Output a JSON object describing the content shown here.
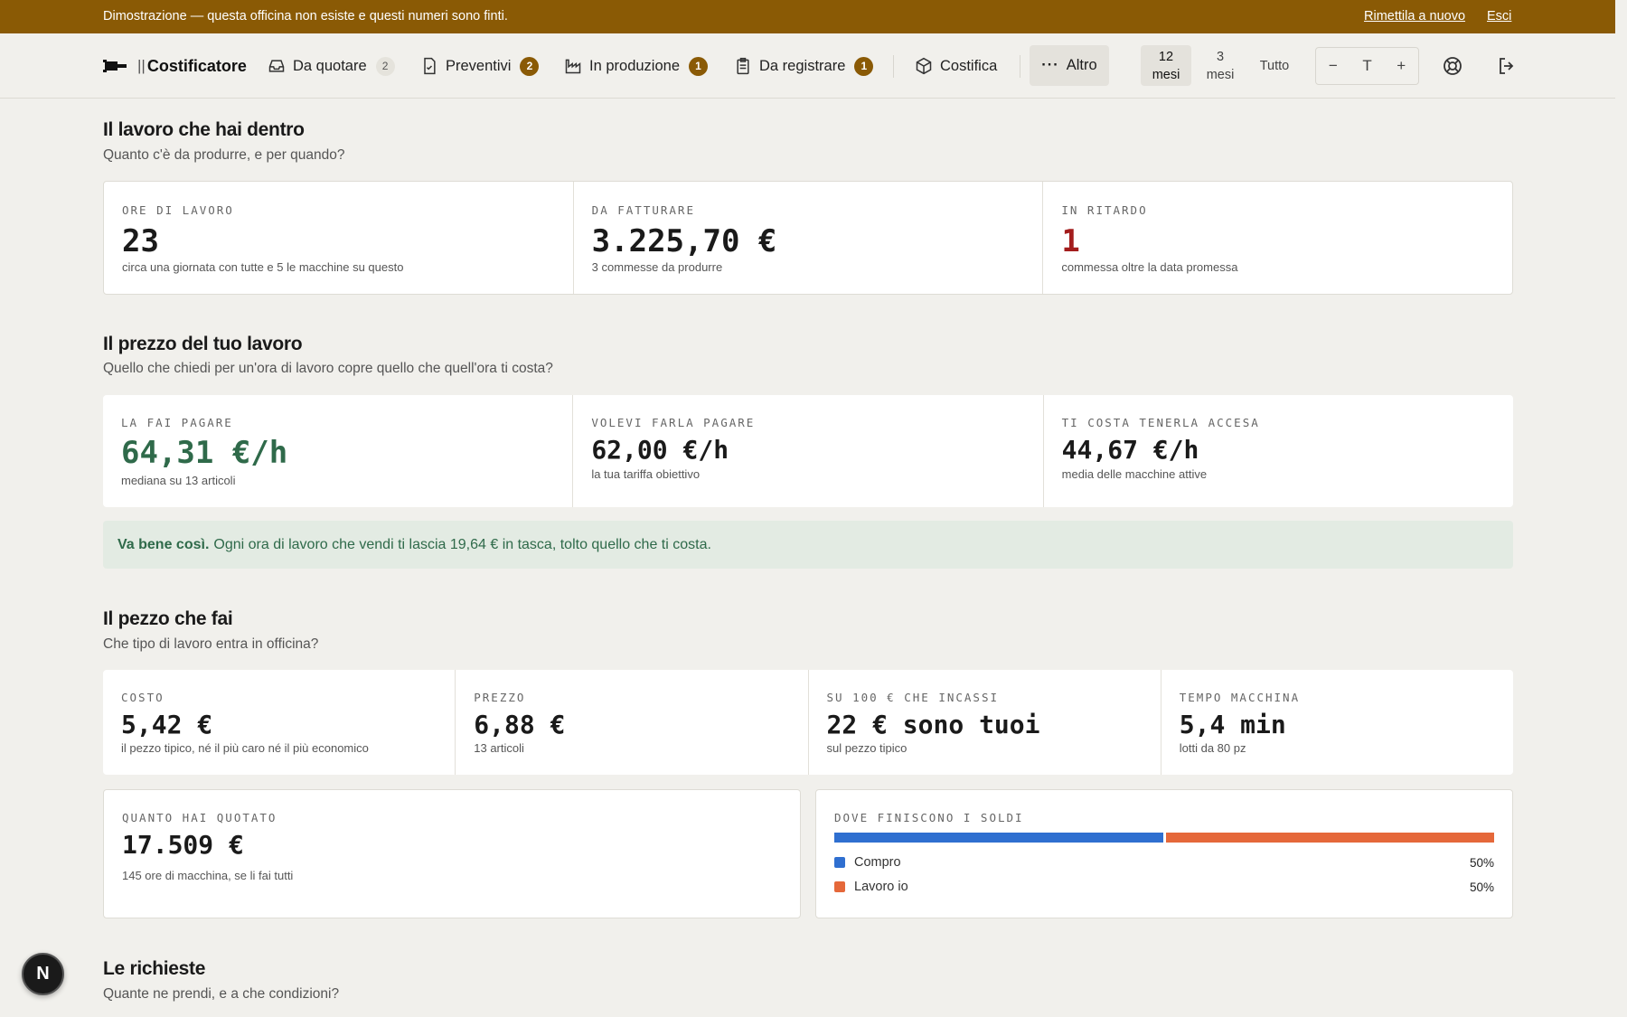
{
  "banner": {
    "message": "Dimostrazione — questa officina non esiste e questi numeri sono finti.",
    "reset": "Rimettila a nuovo",
    "exit": "Esci"
  },
  "nav": {
    "brand": "Costificatore",
    "items": [
      {
        "label": "Da quotare",
        "count": "2",
        "icon": "inbox-icon"
      },
      {
        "label": "Preventivi",
        "count": "2",
        "icon": "file-check-icon"
      },
      {
        "label": "In produzione",
        "count": "1",
        "icon": "factory-icon"
      },
      {
        "label": "Da registrare",
        "count": "1",
        "icon": "clipboard-icon"
      },
      {
        "label": "Costifica",
        "icon": "box-icon"
      }
    ],
    "more": "Altro",
    "ranges": {
      "r12_a": "12",
      "r12_b": "mesi",
      "r3_a": "3",
      "r3_b": "mesi",
      "all": "Tutto"
    },
    "zoom": {
      "minus": "−",
      "text": "T",
      "plus": "+"
    }
  },
  "section1": {
    "title": "Il lavoro che hai dentro",
    "subtitle": "Quanto c'è da produrre, e per quando?",
    "cards": [
      {
        "label": "ORE DI LAVORO",
        "value": "23",
        "note": "circa una giornata con tutte e 5 le macchine su questo"
      },
      {
        "label": "DA FATTURARE",
        "value": "3.225,70 €",
        "note": "3 commesse da produrre"
      },
      {
        "label": "IN RITARDO",
        "value": "1",
        "note": "commessa oltre la data promessa"
      }
    ]
  },
  "section2": {
    "title": "Il prezzo del tuo lavoro",
    "subtitle": "Quello che chiedi per un'ora di lavoro copre quello che quell'ora ti costa?",
    "cards": [
      {
        "label": "LA FAI PAGARE",
        "value": "64,31 €/h",
        "note": "mediana su 13 articoli"
      },
      {
        "label": "VOLEVI FARLA PAGARE",
        "value": "62,00 €/h",
        "note": "la tua tariffa obiettivo"
      },
      {
        "label": "TI COSTA TENERLA ACCESA",
        "value": "44,67 €/h",
        "note": "media delle macchine attive"
      }
    ],
    "verdict_bold": "Va bene così.",
    "verdict_text": "Ogni ora di lavoro che vendi ti lascia 19,64 € in tasca, tolto quello che ti costa."
  },
  "section3": {
    "title": "Il pezzo che fai",
    "subtitle": "Che tipo di lavoro entra in officina?",
    "cards": [
      {
        "label": "COSTO",
        "value": "5,42 €",
        "note": "il pezzo tipico, né il più caro né il più economico"
      },
      {
        "label": "PREZZO",
        "value": "6,88 €",
        "note": "13 articoli"
      },
      {
        "label": "SU 100 € CHE INCASSI",
        "value": "22 € sono tuoi",
        "note": "sul pezzo tipico"
      },
      {
        "label": "TEMPO MACCHINA",
        "value": "5,4 min",
        "note": "lotti da 80 pz"
      }
    ],
    "quoted": {
      "label": "QUANTO HAI QUOTATO",
      "value": "17.509 €",
      "note": "145 ore di macchina, se li fai tutti"
    },
    "split": {
      "label": "DOVE FINISCONO I SOLDI",
      "parts": [
        {
          "name": "Compro",
          "pct": "50%",
          "fraction": 0.5,
          "color": "#2f6fd0"
        },
        {
          "name": "Lavoro io",
          "pct": "50%",
          "fraction": 0.5,
          "color": "#e5683a"
        }
      ]
    }
  },
  "section4": {
    "title": "Le richieste",
    "subtitle": "Quante ne prendi, e a che condizioni?"
  },
  "fab": "N"
}
